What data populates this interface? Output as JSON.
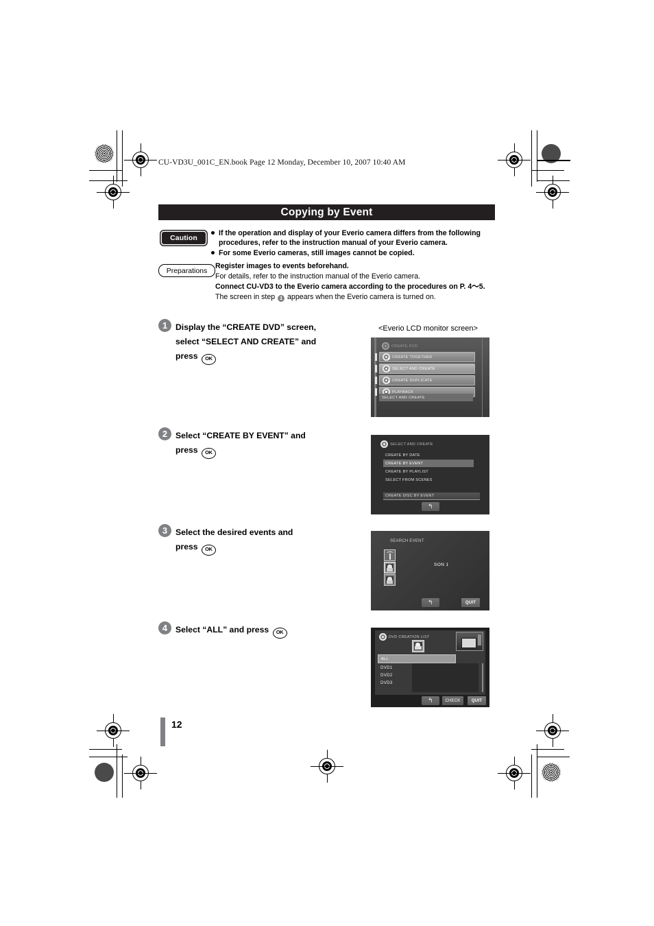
{
  "running_head": "CU-VD3U_001C_EN.book  Page 12  Monday, December 10, 2007  10:40 AM",
  "section": {
    "title": "Copying by Event"
  },
  "caution": {
    "badge_label": "Caution",
    "bullets": [
      "If the operation and display of your Everio camera differs from the following procedures, refer to the instruction manual of your Everio camera.",
      "For some Everio cameras, still images cannot be copied."
    ]
  },
  "preparations": {
    "badge_label": "Preparations",
    "line1_bold": "Register images to events beforehand.",
    "line2": "For details, refer to the instruction manual of the Everio camera.",
    "line3_bold": "Connect CU-VD3 to the Everio camera according to the procedures on P. 4～5.",
    "line4_pre": "The screen in step ",
    "line4_step": "1",
    "line4_post": " appears when the Everio camera is turned on."
  },
  "lcd_caption": "<Everio LCD monitor screen>",
  "steps": [
    {
      "number": "1",
      "line1": "Display the “CREATE DVD” screen,",
      "line2": "select “SELECT AND CREATE” and",
      "line3_pre": "press ",
      "ok_label": "OK"
    },
    {
      "number": "2",
      "line1": "Select “CREATE BY EVENT” and",
      "line3_pre": "press ",
      "ok_label": "OK"
    },
    {
      "number": "3",
      "line1": "Select the desired events and",
      "line3_pre": "press ",
      "ok_label": "OK"
    },
    {
      "number": "4",
      "line1": "Select “ALL” and press ",
      "ok_label": "OK"
    }
  ],
  "screens": {
    "screen1": {
      "header": "CREATE DVD",
      "items": [
        "CREATE TOGETHER",
        "SELECT AND CREATE",
        "CREATE DUPLICATE",
        "PLAYBACK"
      ],
      "footer": "SELECT AND CREATE",
      "selected_item": "SELECT AND CREATE"
    },
    "screen2": {
      "header": "SELECT AND CREATE",
      "items": [
        "CREATE BY DATE",
        "CREATE BY EVENT",
        "CREATE BY PLAYLIST",
        "SELECT FROM SCENES"
      ],
      "selected_item": "CREATE BY EVENT",
      "statusbar": "CREATE DISC BY EVENT",
      "back_label": "↰"
    },
    "screen3": {
      "title": "SEARCH EVENT",
      "event_label": "SON 1",
      "icons": [
        "palm-tree-event-icon",
        "person-event-icon",
        "baby-event-icon"
      ],
      "back_label": "↰",
      "quit_label": "QUIT"
    },
    "screen4": {
      "header": "DVD CREATION LIST",
      "all_label": "ALL",
      "dvd_items": [
        "DVD1",
        "DVD2",
        "DVD3"
      ],
      "back_label": "↰",
      "check_label": "CHECK",
      "quit_label": "QUIT"
    }
  },
  "page_number": "12"
}
